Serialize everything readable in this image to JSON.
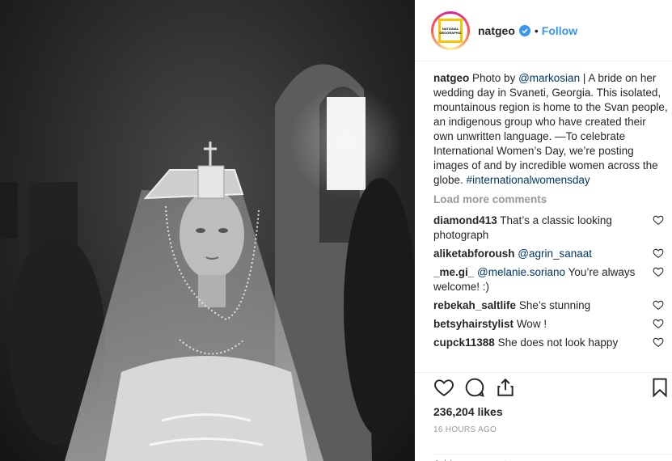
{
  "header": {
    "avatar_text": "NATIONAL GEOGRAPHIC",
    "username": "natgeo",
    "dot": "•",
    "follow_label": "Follow"
  },
  "caption": {
    "username": "natgeo",
    "text_before": "Photo by",
    "mention": "@markosian",
    "text_after": "| A bride on her wedding day in Svaneti, Georgia. This isolated, mountainous region is home to the Svan people, an indigenous group who have created their own unwritten language. —To celebrate International Women’s Day, we’re posting images of and by incredible women across the globe.",
    "hashtag": "#internationalwomensday"
  },
  "load_more_label": "Load more comments",
  "comments": [
    {
      "username": "diamond413",
      "mention": "",
      "text": "That’s a classic looking photograph"
    },
    {
      "username": "aliketabforoush",
      "mention": "@agrin_sanaat",
      "text": ""
    },
    {
      "username": "_me.gi_",
      "mention": "@melanie.soriano",
      "text": "You’re always welcome! :)"
    },
    {
      "username": "rebekah_saltlife",
      "mention": "",
      "text": "She’s stunning"
    },
    {
      "username": "betsyhairstylist",
      "mention": "",
      "text": "Wow !"
    },
    {
      "username": "cupck11388",
      "mention": "",
      "text": "She does not look happy"
    }
  ],
  "likes": "236,204 likes",
  "timestamp": "16 HOURS AGO",
  "add_comment_placeholder": "Add a comment…",
  "icons": {
    "like": "heart-icon",
    "comment": "comment-icon",
    "share": "share-icon",
    "save": "bookmark-icon",
    "verified": "verified-badge-icon"
  },
  "colors": {
    "follow": "#3897f0",
    "link": "#003569",
    "muted": "#999999",
    "verified": "#3897f0",
    "logo_frame": "#f7c600"
  }
}
